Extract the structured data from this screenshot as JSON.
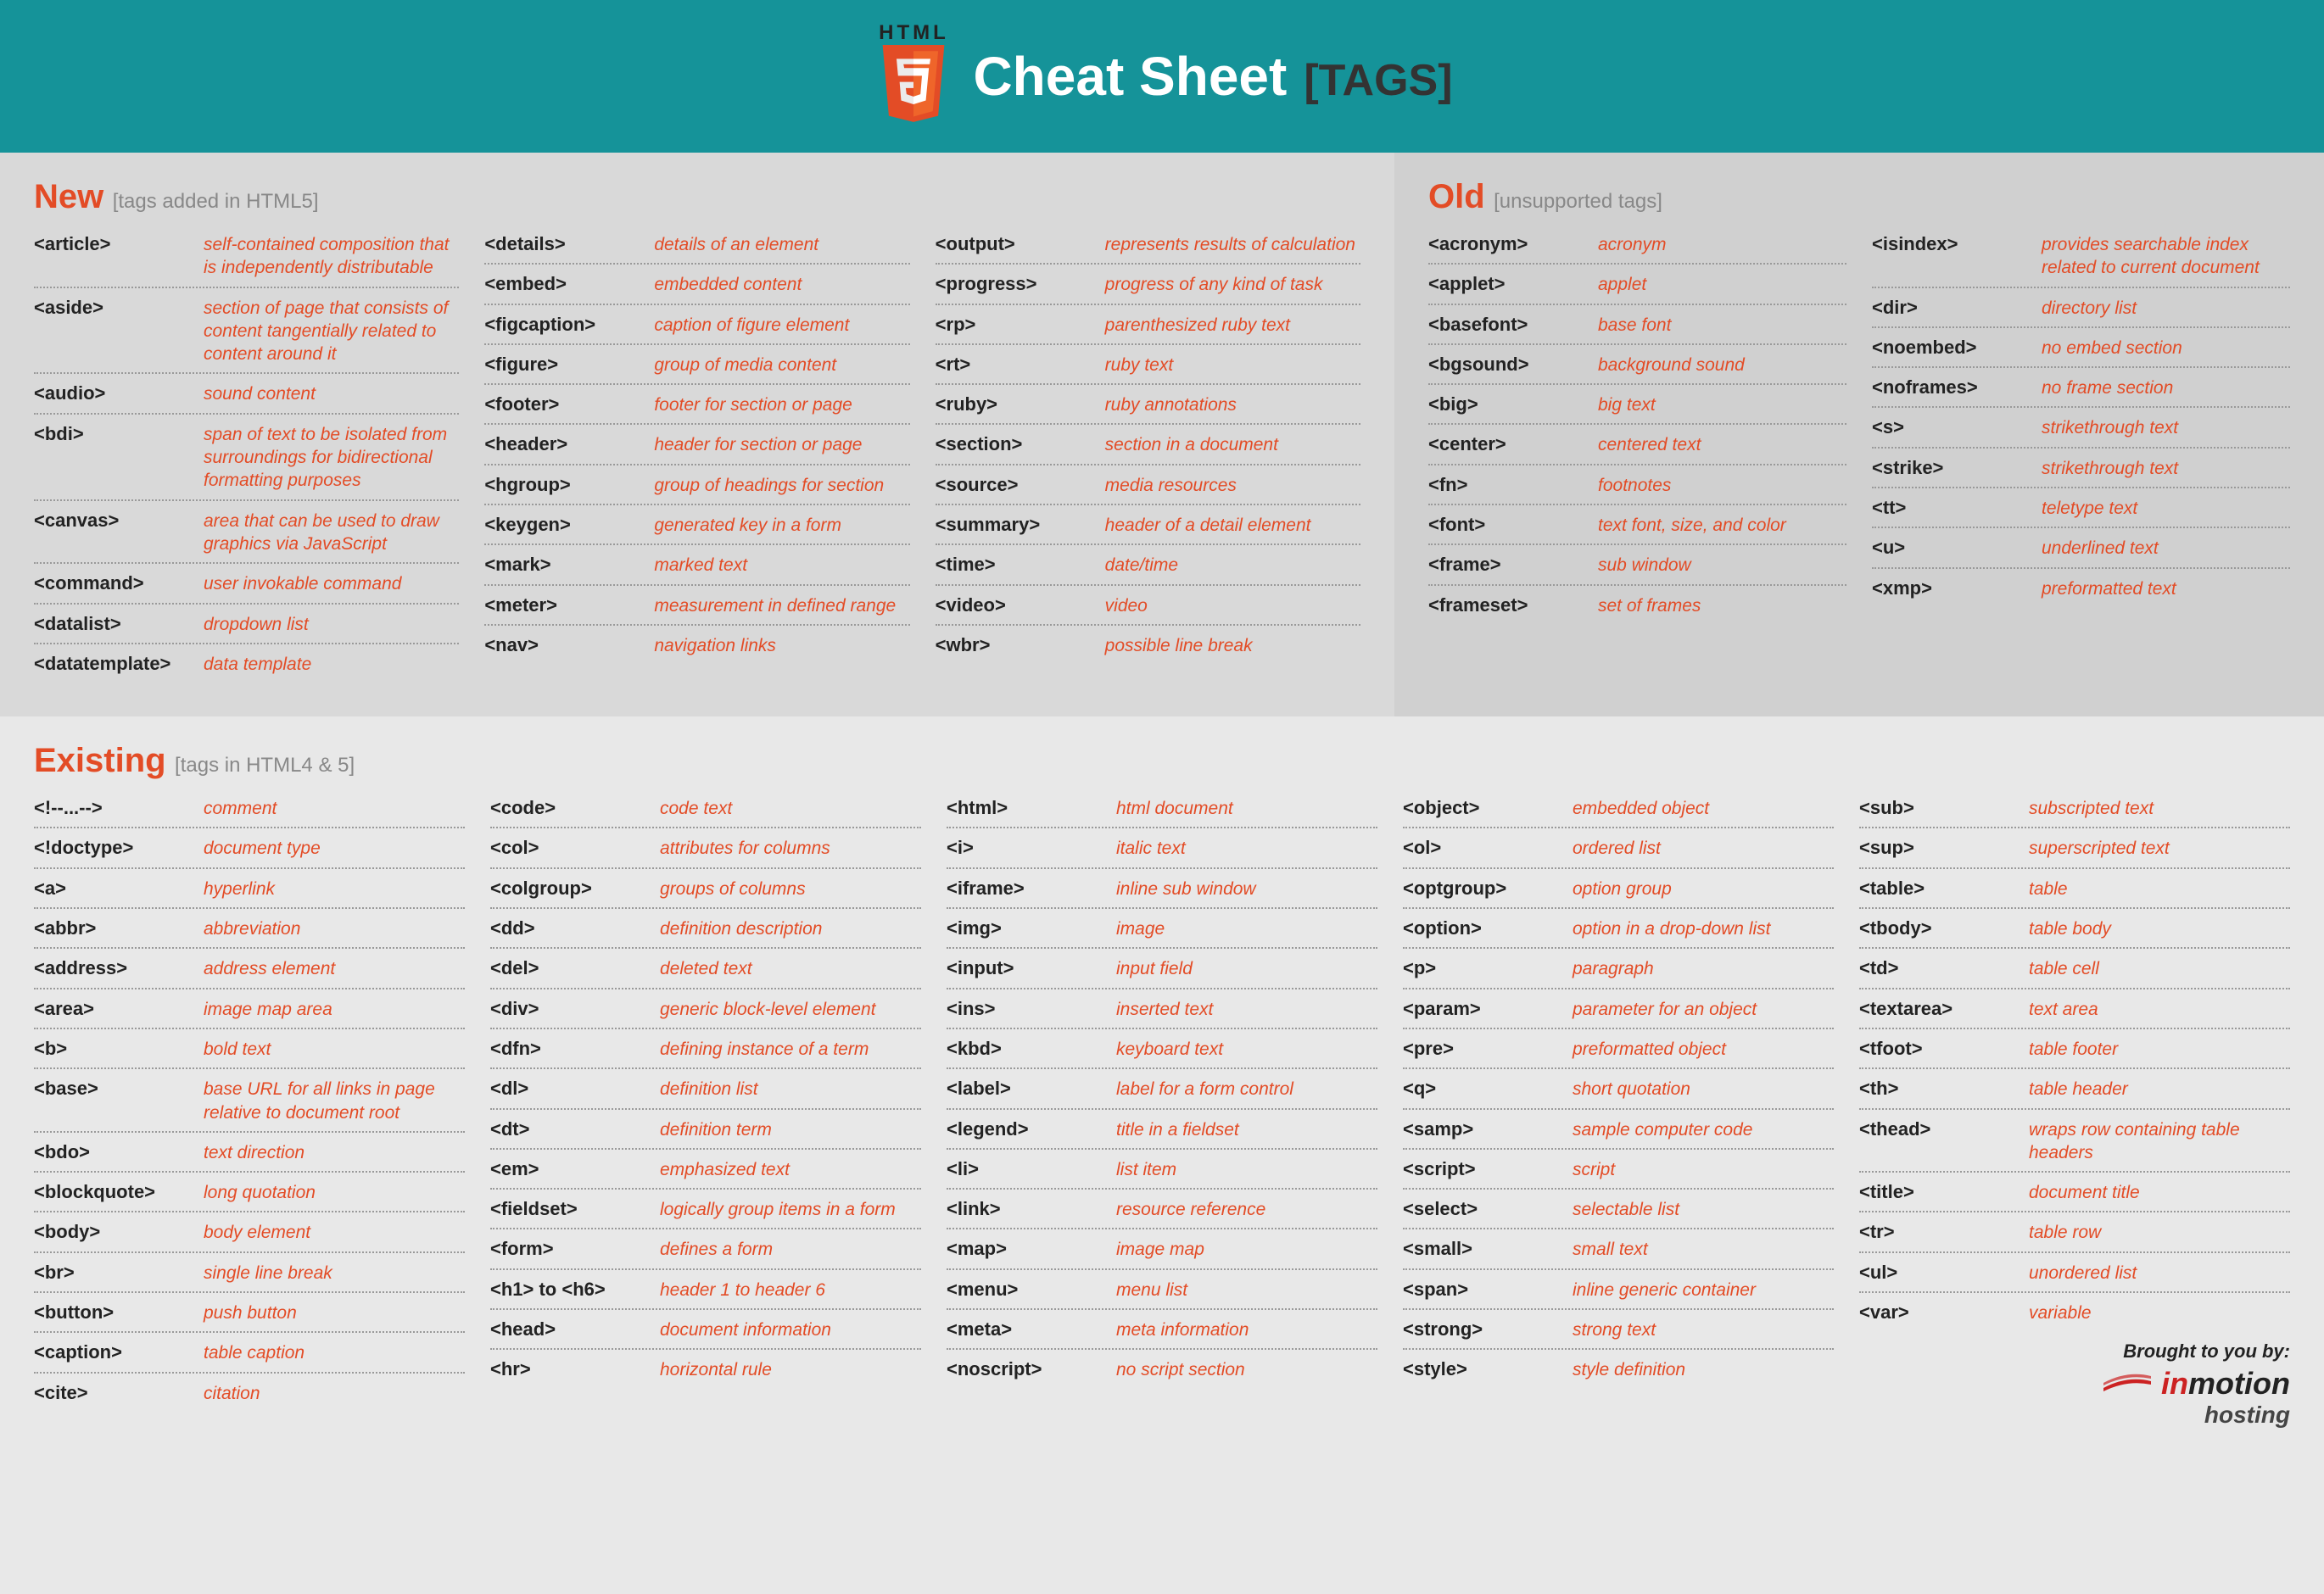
{
  "banner": {
    "badge_top": "HTML",
    "title": "Cheat Sheet",
    "suffix": "[TAGS]"
  },
  "sections": {
    "new": {
      "title": "New",
      "sub": "[tags added in HTML5]"
    },
    "old": {
      "title": "Old",
      "sub": "[unsupported tags]"
    },
    "existing": {
      "title": "Existing",
      "sub": "[tags in HTML4 & 5]"
    }
  },
  "new_tags": {
    "col0": [
      {
        "t": "<article>",
        "d": "self-contained composition that is independently distributable"
      },
      {
        "t": "<aside>",
        "d": "section of page that consists of content tangentially related to content around it"
      },
      {
        "t": "<audio>",
        "d": "sound content"
      },
      {
        "t": "<bdi>",
        "d": "span of text to be isolated from surroundings for bidirectional formatting purposes"
      },
      {
        "t": "<canvas>",
        "d": "area that can be used to draw graphics via JavaScript"
      },
      {
        "t": "<command>",
        "d": "user invokable command"
      },
      {
        "t": "<datalist>",
        "d": "dropdown list"
      },
      {
        "t": "<datatemplate>",
        "d": "data template"
      }
    ],
    "col1": [
      {
        "t": "<details>",
        "d": "details of an element"
      },
      {
        "t": "<embed>",
        "d": "embedded content"
      },
      {
        "t": "<figcaption>",
        "d": "caption of figure element"
      },
      {
        "t": "<figure>",
        "d": "group of media content"
      },
      {
        "t": "<footer>",
        "d": "footer for section or page"
      },
      {
        "t": "<header>",
        "d": "header for section or page"
      },
      {
        "t": "<hgroup>",
        "d": "group of headings for section"
      },
      {
        "t": "<keygen>",
        "d": "generated key in a form"
      },
      {
        "t": "<mark>",
        "d": "marked text"
      },
      {
        "t": "<meter>",
        "d": "measurement in defined range"
      },
      {
        "t": "<nav>",
        "d": "navigation links"
      }
    ],
    "col2": [
      {
        "t": "<output>",
        "d": "represents results of calculation"
      },
      {
        "t": "<progress>",
        "d": "progress of any kind of task"
      },
      {
        "t": "<rp>",
        "d": "parenthesized ruby text"
      },
      {
        "t": "<rt>",
        "d": "ruby text"
      },
      {
        "t": "<ruby>",
        "d": "ruby annotations"
      },
      {
        "t": "<section>",
        "d": "section in a document"
      },
      {
        "t": "<source>",
        "d": "media resources"
      },
      {
        "t": "<summary>",
        "d": "header of a detail element"
      },
      {
        "t": "<time>",
        "d": "date/time"
      },
      {
        "t": "<video>",
        "d": "video"
      },
      {
        "t": "<wbr>",
        "d": "possible line break"
      }
    ]
  },
  "old_tags": {
    "col0": [
      {
        "t": "<acronym>",
        "d": "acronym"
      },
      {
        "t": "<applet>",
        "d": "applet"
      },
      {
        "t": "<basefont>",
        "d": "base font"
      },
      {
        "t": "<bgsound>",
        "d": "background sound"
      },
      {
        "t": "<big>",
        "d": "big text"
      },
      {
        "t": "<center>",
        "d": "centered text"
      },
      {
        "t": "<fn>",
        "d": "footnotes"
      },
      {
        "t": "<font>",
        "d": "text font, size, and color"
      },
      {
        "t": "<frame>",
        "d": "sub window"
      },
      {
        "t": "<frameset>",
        "d": "set of frames"
      }
    ],
    "col1": [
      {
        "t": "<isindex>",
        "d": "provides searchable index related to current document"
      },
      {
        "t": "<dir>",
        "d": "directory list"
      },
      {
        "t": "<noembed>",
        "d": "no embed section"
      },
      {
        "t": "<noframes>",
        "d": "no frame section"
      },
      {
        "t": "<s>",
        "d": "strikethrough text"
      },
      {
        "t": "<strike>",
        "d": "strikethrough text"
      },
      {
        "t": "<tt>",
        "d": "teletype text"
      },
      {
        "t": "<u>",
        "d": "underlined text"
      },
      {
        "t": "<xmp>",
        "d": "preformatted text"
      }
    ]
  },
  "existing_tags": {
    "col0": [
      {
        "t": "<!--...-->",
        "d": "comment"
      },
      {
        "t": "<!doctype>",
        "d": "document type"
      },
      {
        "t": "<a>",
        "d": "hyperlink"
      },
      {
        "t": "<abbr>",
        "d": "abbreviation"
      },
      {
        "t": "<address>",
        "d": "address element"
      },
      {
        "t": "<area>",
        "d": "image map area"
      },
      {
        "t": "<b>",
        "d": "bold text"
      },
      {
        "t": "<base>",
        "d": "base URL for all links in page relative to document root"
      },
      {
        "t": "<bdo>",
        "d": "text direction"
      },
      {
        "t": "<blockquote>",
        "d": "long quotation"
      },
      {
        "t": "<body>",
        "d": "body element"
      },
      {
        "t": "<br>",
        "d": "single line break"
      },
      {
        "t": "<button>",
        "d": "push button"
      },
      {
        "t": "<caption>",
        "d": "table caption"
      },
      {
        "t": "<cite>",
        "d": "citation"
      }
    ],
    "col1": [
      {
        "t": "<code>",
        "d": "code text"
      },
      {
        "t": "<col>",
        "d": "attributes for columns"
      },
      {
        "t": "<colgroup>",
        "d": "groups of columns"
      },
      {
        "t": "<dd>",
        "d": "definition description"
      },
      {
        "t": "<del>",
        "d": "deleted text"
      },
      {
        "t": "<div>",
        "d": "generic block-level element"
      },
      {
        "t": "<dfn>",
        "d": "defining instance of a term"
      },
      {
        "t": "<dl>",
        "d": "definition list"
      },
      {
        "t": "<dt>",
        "d": "definition term"
      },
      {
        "t": "<em>",
        "d": "emphasized text"
      },
      {
        "t": "<fieldset>",
        "d": "logically group items in a form"
      },
      {
        "t": "<form>",
        "d": "defines a form"
      },
      {
        "t": "<h1> to <h6>",
        "d": "header 1 to header 6"
      },
      {
        "t": "<head>",
        "d": "document information"
      },
      {
        "t": "<hr>",
        "d": "horizontal rule"
      }
    ],
    "col2": [
      {
        "t": "<html>",
        "d": "html document"
      },
      {
        "t": "<i>",
        "d": "italic text"
      },
      {
        "t": "<iframe>",
        "d": "inline sub window"
      },
      {
        "t": "<img>",
        "d": "image"
      },
      {
        "t": "<input>",
        "d": "input field"
      },
      {
        "t": "<ins>",
        "d": "inserted text"
      },
      {
        "t": "<kbd>",
        "d": "keyboard text"
      },
      {
        "t": "<label>",
        "d": "label for a form control"
      },
      {
        "t": "<legend>",
        "d": "title in a fieldset"
      },
      {
        "t": "<li>",
        "d": "list item"
      },
      {
        "t": "<link>",
        "d": "resource reference"
      },
      {
        "t": "<map>",
        "d": "image map"
      },
      {
        "t": "<menu>",
        "d": "menu list"
      },
      {
        "t": "<meta>",
        "d": "meta information"
      },
      {
        "t": "<noscript>",
        "d": "no script section"
      }
    ],
    "col3": [
      {
        "t": "<object>",
        "d": "embedded object"
      },
      {
        "t": "<ol>",
        "d": "ordered list"
      },
      {
        "t": "<optgroup>",
        "d": "option group"
      },
      {
        "t": "<option>",
        "d": "option in a drop-down list"
      },
      {
        "t": "<p>",
        "d": "paragraph"
      },
      {
        "t": "<param>",
        "d": "parameter for an object"
      },
      {
        "t": "<pre>",
        "d": "preformatted object"
      },
      {
        "t": "<q>",
        "d": "short quotation"
      },
      {
        "t": "<samp>",
        "d": "sample computer code"
      },
      {
        "t": "<script>",
        "d": "script"
      },
      {
        "t": "<select>",
        "d": "selectable list"
      },
      {
        "t": "<small>",
        "d": "small text"
      },
      {
        "t": "<span>",
        "d": "inline generic container"
      },
      {
        "t": "<strong>",
        "d": "strong text"
      },
      {
        "t": "<style>",
        "d": "style definition"
      }
    ],
    "col4": [
      {
        "t": "<sub>",
        "d": "subscripted text"
      },
      {
        "t": "<sup>",
        "d": "superscripted text"
      },
      {
        "t": "<table>",
        "d": "table"
      },
      {
        "t": "<tbody>",
        "d": "table body"
      },
      {
        "t": "<td>",
        "d": "table cell"
      },
      {
        "t": "<textarea>",
        "d": "text area"
      },
      {
        "t": "<tfoot>",
        "d": "table footer"
      },
      {
        "t": "<th>",
        "d": "table header"
      },
      {
        "t": "<thead>",
        "d": "wraps row containing table headers"
      },
      {
        "t": "<title>",
        "d": "document title"
      },
      {
        "t": "<tr>",
        "d": "table row"
      },
      {
        "t": "<ul>",
        "d": "unordered list"
      },
      {
        "t": "<var>",
        "d": "variable"
      }
    ]
  },
  "footer": {
    "brought": "Brought to you by:",
    "brand_in": "in",
    "brand_motion": "motion",
    "hosting": "hosting"
  }
}
